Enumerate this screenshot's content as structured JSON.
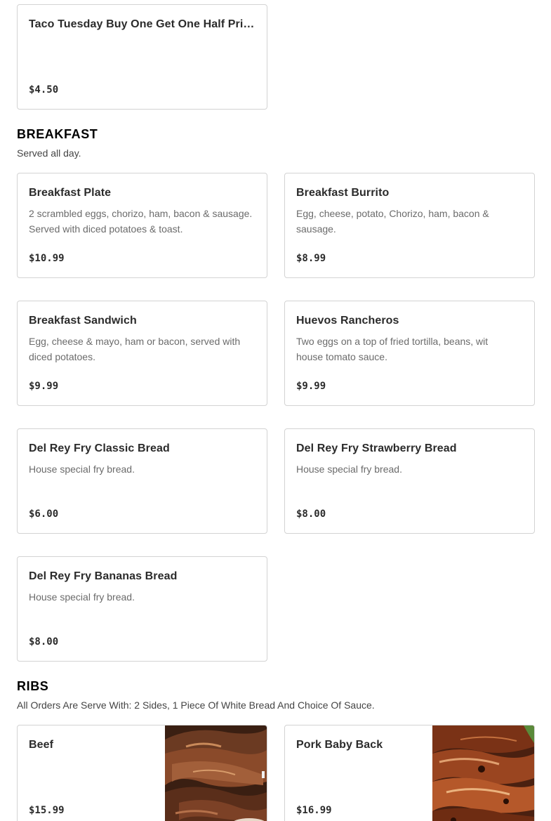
{
  "top_item": {
    "name": "Taco Tuesday Buy One Get One Half Price...",
    "price": "$4.50"
  },
  "breakfast": {
    "title": "BREAKFAST",
    "subtitle": "Served all day.",
    "items": [
      {
        "name": "Breakfast Plate",
        "desc": "2 scrambled eggs, chorizo, ham, bacon & sausage. Served with diced potatoes & toast.",
        "price": "$10.99"
      },
      {
        "name": "Breakfast Burrito",
        "desc": "Egg, cheese, potato, Chorizo, ham, bacon & sausage.",
        "price": "$8.99"
      },
      {
        "name": "Breakfast Sandwich",
        "desc": "Egg, cheese & mayo, ham or bacon, served with diced potatoes.",
        "price": "$9.99"
      },
      {
        "name": "Huevos Rancheros",
        "desc": "Two eggs on a top of fried tortilla, beans, wit house tomato sauce.",
        "price": "$9.99"
      },
      {
        "name": "Del Rey Fry Classic Bread",
        "desc": "House special fry bread.",
        "price": "$6.00"
      },
      {
        "name": "Del Rey Fry Strawberry Bread",
        "desc": "House special fry bread.",
        "price": "$8.00"
      },
      {
        "name": "Del Rey Fry Bananas Bread",
        "desc": "House special fry bread.",
        "price": "$8.00"
      }
    ]
  },
  "ribs": {
    "title": "RIBS",
    "subtitle": "All Orders Are Serve With: 2 Sides, 1 Piece Of White Bread And Choice Of Sauce.",
    "items": [
      {
        "name": "Beef",
        "price": "$15.99"
      },
      {
        "name": "Pork Baby Back",
        "price": "$16.99"
      }
    ]
  }
}
